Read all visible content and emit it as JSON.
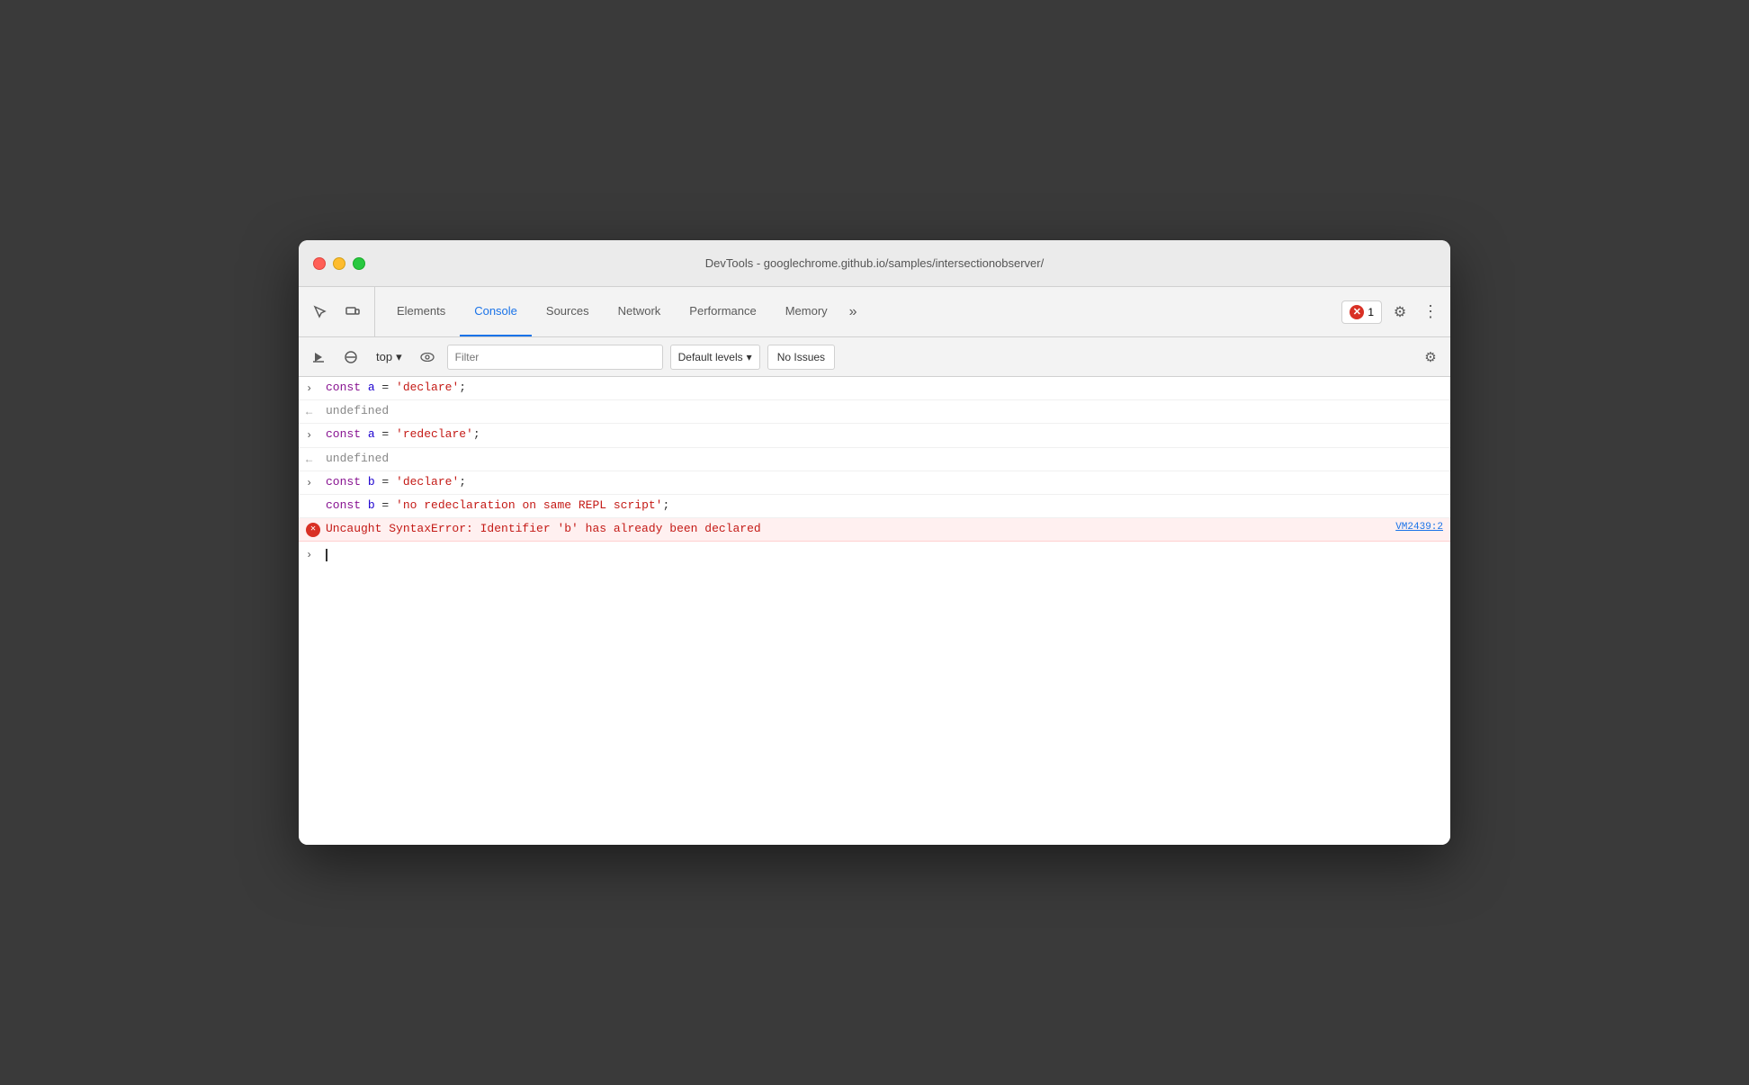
{
  "window": {
    "title": "DevTools - googlechrome.github.io/samples/intersectionobserver/"
  },
  "tabs": {
    "items": [
      {
        "id": "elements",
        "label": "Elements",
        "active": false
      },
      {
        "id": "console",
        "label": "Console",
        "active": true
      },
      {
        "id": "sources",
        "label": "Sources",
        "active": false
      },
      {
        "id": "network",
        "label": "Network",
        "active": false
      },
      {
        "id": "performance",
        "label": "Performance",
        "active": false
      },
      {
        "id": "memory",
        "label": "Memory",
        "active": false
      }
    ],
    "overflow_label": "»"
  },
  "error_badge": {
    "count": "1"
  },
  "console_toolbar": {
    "context_label": "top",
    "filter_placeholder": "Filter",
    "levels_label": "Default levels",
    "no_issues_label": "No Issues"
  },
  "console_lines": [
    {
      "type": "input",
      "arrow": "›",
      "code": "const a = 'declare';"
    },
    {
      "type": "result",
      "arrow": "←",
      "text": "undefined"
    },
    {
      "type": "input",
      "arrow": "›",
      "code": "const a = 'redeclare';"
    },
    {
      "type": "result",
      "arrow": "←",
      "text": "undefined"
    },
    {
      "type": "input",
      "arrow": "›",
      "code_line1": "const b = 'declare';",
      "code_line2": "const b = 'no redeclaration on same REPL script';"
    },
    {
      "type": "error",
      "message": "Uncaught SyntaxError: Identifier 'b' has already been declared",
      "source": "VM2439:2"
    }
  ],
  "icons": {
    "cursor_icon": "⊲",
    "inspect_icon": "↖",
    "device_icon": "▭",
    "run_icon": "▶",
    "clear_icon": "⊘",
    "watch_icon": "👁",
    "expand_arrow": "›",
    "return_arrow": "←",
    "error_x": "✕",
    "dropdown_arrow": "▾",
    "gear": "⚙",
    "more": "⋮",
    "overflow": "»"
  }
}
